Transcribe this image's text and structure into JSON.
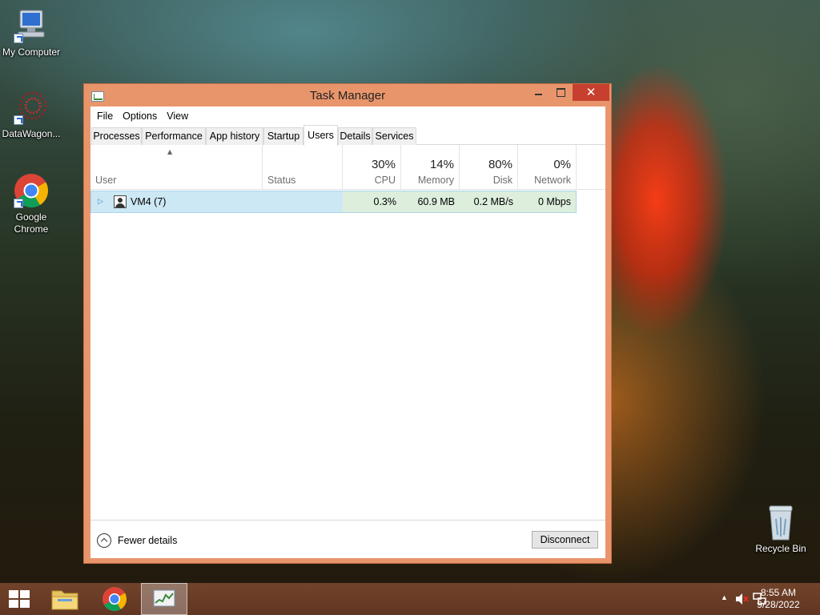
{
  "desktop": {
    "icons": [
      {
        "label": "My Computer"
      },
      {
        "label": "DataWagon..."
      },
      {
        "label": "Google Chrome"
      },
      {
        "label": "Recycle Bin"
      }
    ]
  },
  "window": {
    "title": "Task Manager",
    "close_glyph": "✕",
    "menu": [
      "File",
      "Options",
      "View"
    ],
    "tabs": [
      "Processes",
      "Performance",
      "App history",
      "Startup",
      "Users",
      "Details",
      "Services"
    ],
    "active_tab": "Users",
    "columns": {
      "user": "User",
      "status": "Status",
      "cpu": {
        "pct": "30%",
        "label": "CPU"
      },
      "memory": {
        "pct": "14%",
        "label": "Memory"
      },
      "disk": {
        "pct": "80%",
        "label": "Disk"
      },
      "network": {
        "pct": "0%",
        "label": "Network"
      }
    },
    "rows": [
      {
        "user": "VM4 (7)",
        "status": "",
        "cpu": "0.3%",
        "memory": "60.9 MB",
        "disk": "0.2 MB/s",
        "network": "0 Mbps"
      }
    ],
    "footer": {
      "fewer_details": "Fewer details",
      "disconnect": "Disconnect"
    }
  },
  "taskbar": {
    "time": "8:55 AM",
    "date": "9/28/2022"
  },
  "colors": {
    "window_frame": "#e9956c",
    "close_button": "#c7402f",
    "selected_row": "#cce8f4",
    "taskbar": "#7a4630"
  }
}
